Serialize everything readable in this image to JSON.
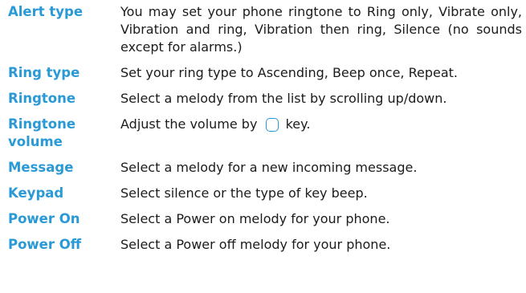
{
  "settings": [
    {
      "term": "Alert type",
      "desc": "You may set your phone ringtone to Ring only, Vibrate only, Vibration and ring, Vibration then ring, Silence (no sounds except for alarms.)"
    },
    {
      "term": "Ring type",
      "desc": "Set your ring type to Ascending, Beep once, Repeat."
    },
    {
      "term": "Ringtone",
      "desc": "Select a melody from the list by scrolling up/down."
    },
    {
      "term": "Ringtone volume",
      "desc_before": "Adjust the volume by",
      "icon": "navigation-key-icon",
      "desc_after": "key."
    },
    {
      "term": "Message",
      "desc": "Select a melody for a new incoming message."
    },
    {
      "term": "Keypad",
      "desc": "Select silence or the type of key beep."
    },
    {
      "term": "Power On",
      "desc": "Select a Power on melody for your phone."
    },
    {
      "term": "Power Off",
      "desc": "Select a Power off melody for your phone."
    }
  ],
  "colors": {
    "term": "#2a9ad6",
    "text": "#1b1b1b"
  }
}
